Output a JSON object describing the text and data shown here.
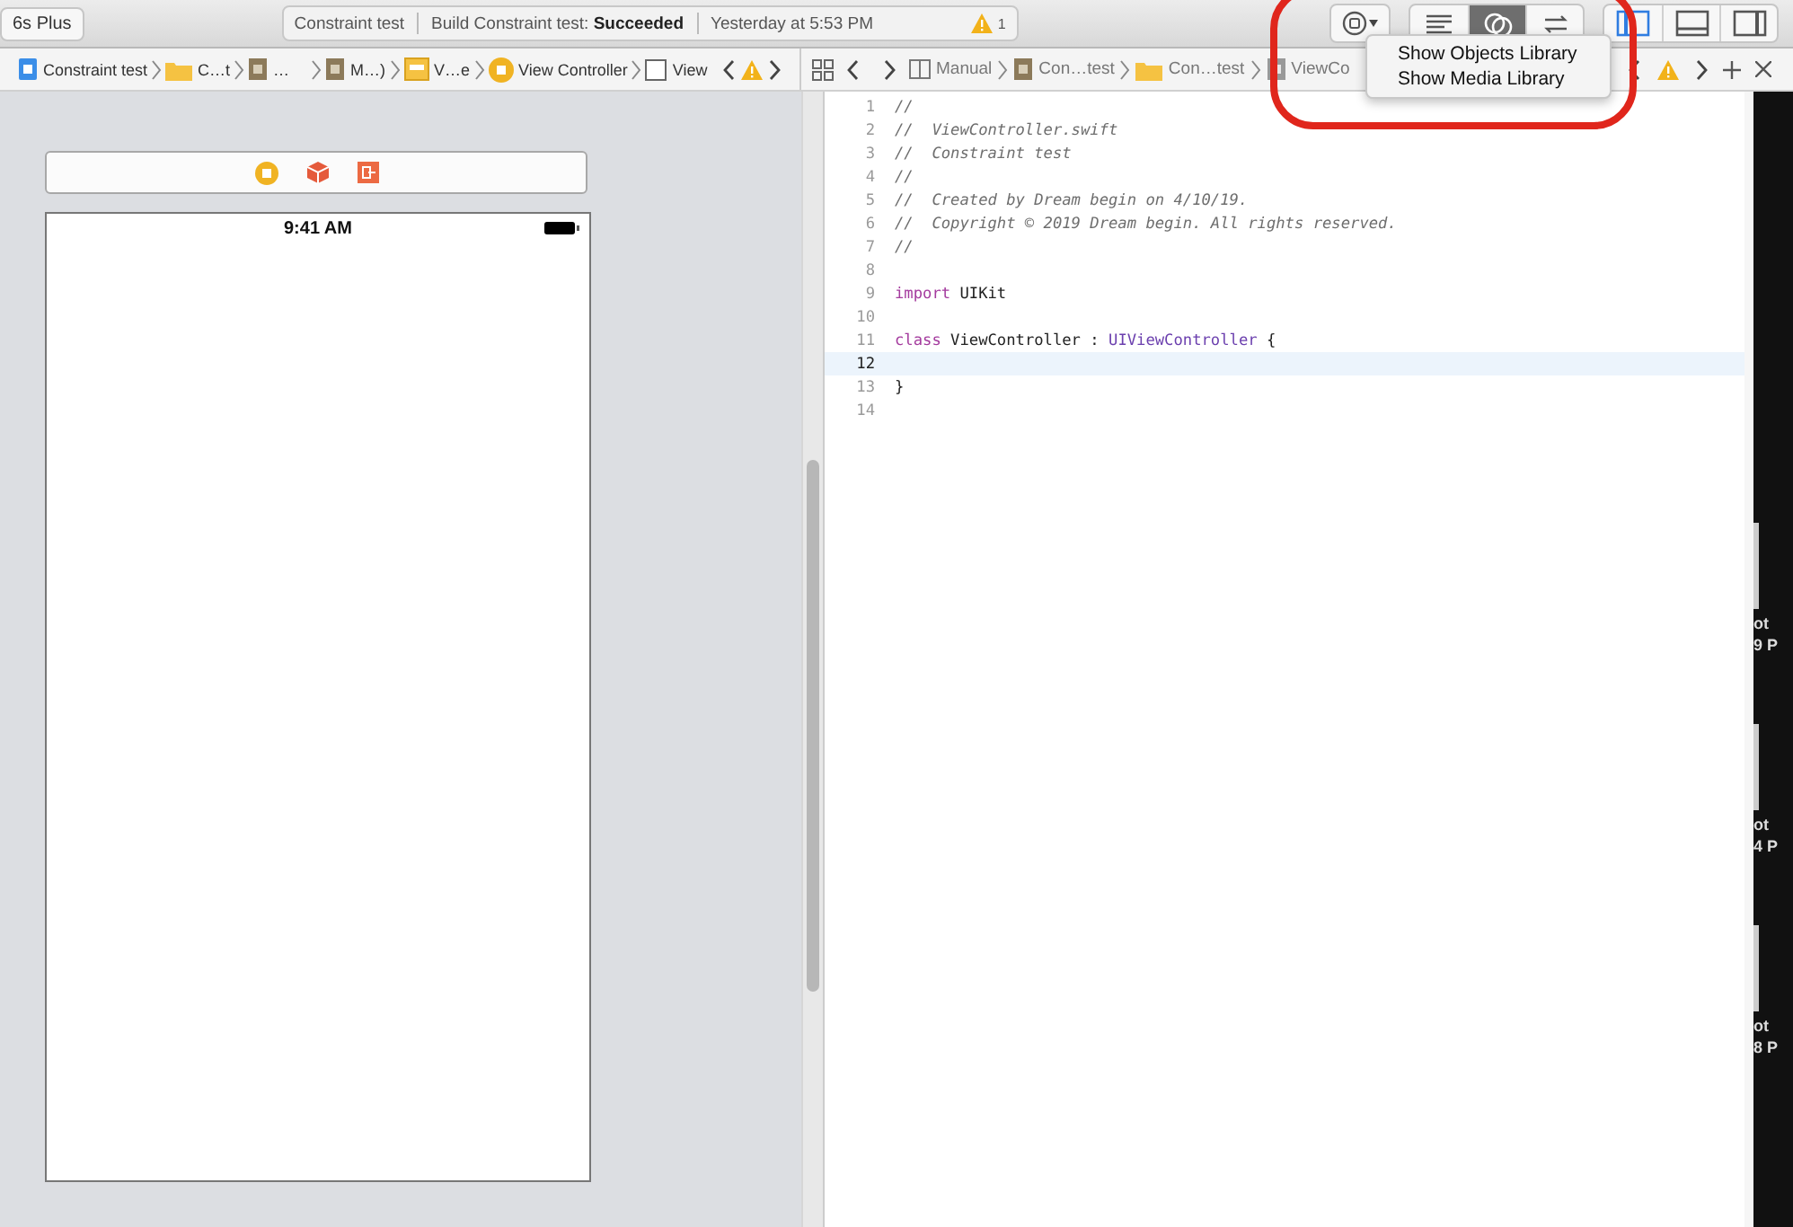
{
  "toolbar": {
    "scheme": "6s Plus",
    "activity": {
      "project": "Constraint test",
      "status": "Build Constraint test: **Succeeded**",
      "time": "Yesterday at 5:53 PM",
      "warnings": "1"
    },
    "editor_modes": [
      {
        "kind": "standard",
        "selected": false
      },
      {
        "kind": "assistant",
        "selected": true
      },
      {
        "kind": "version",
        "selected": false
      }
    ],
    "panels": [
      {
        "kind": "navigator",
        "on": true
      },
      {
        "kind": "debug",
        "on": false
      },
      {
        "kind": "utilities",
        "on": false
      }
    ]
  },
  "library_menu": {
    "items": [
      "Show Objects Library",
      "Show Media Library"
    ]
  },
  "highlight": {
    "color": "#e0261c"
  },
  "jump_bar_left": [
    {
      "kind": "project",
      "label": "Constraint test"
    },
    {
      "kind": "folder",
      "label": "C…t"
    },
    {
      "kind": "file",
      "label": "…"
    },
    {
      "kind": "file",
      "label": "M…)"
    },
    {
      "kind": "storyboard",
      "label": "V…e"
    },
    {
      "kind": "controller",
      "label": "View Controller"
    },
    {
      "kind": "view",
      "label": "View"
    }
  ],
  "jump_bar_right": [
    {
      "kind": "manual",
      "label": "Manual"
    },
    {
      "kind": "file",
      "label": "Con…test"
    },
    {
      "kind": "folder",
      "label": "Con…test"
    },
    {
      "kind": "swift",
      "label": "ViewCo"
    }
  ],
  "canvas": {
    "status_time": "9:41 AM"
  },
  "code": [
    {
      "number": "1",
      "current": false,
      "tokens": [
        {
          "kind": "comment",
          "text": "//"
        }
      ]
    },
    {
      "number": "2",
      "current": false,
      "tokens": [
        {
          "kind": "comment",
          "text": "//  ViewController.swift"
        }
      ]
    },
    {
      "number": "3",
      "current": false,
      "tokens": [
        {
          "kind": "comment",
          "text": "//  Constraint test"
        }
      ]
    },
    {
      "number": "4",
      "current": false,
      "tokens": [
        {
          "kind": "comment",
          "text": "//"
        }
      ]
    },
    {
      "number": "5",
      "current": false,
      "tokens": [
        {
          "kind": "comment",
          "text": "//  Created by Dream begin on 4/10/19."
        }
      ]
    },
    {
      "number": "6",
      "current": false,
      "tokens": [
        {
          "kind": "comment",
          "text": "//  Copyright © 2019 Dream begin. All rights reserved."
        }
      ]
    },
    {
      "number": "7",
      "current": false,
      "tokens": [
        {
          "kind": "comment",
          "text": "//"
        }
      ]
    },
    {
      "number": "8",
      "current": false
    },
    {
      "number": "9",
      "current": false,
      "tokens": [
        {
          "kind": "keyword",
          "text": "import"
        },
        {
          "kind": "plain",
          "text": " UIKit"
        }
      ]
    },
    {
      "number": "10",
      "current": false
    },
    {
      "number": "11",
      "current": false,
      "tokens": [
        {
          "kind": "keyword",
          "text": "class"
        },
        {
          "kind": "plain",
          "text": " ViewController : "
        },
        {
          "kind": "type",
          "text": "UIViewController"
        },
        {
          "kind": "plain",
          "text": " {"
        }
      ]
    },
    {
      "number": "12",
      "current": true
    },
    {
      "number": "13",
      "current": false,
      "tokens": [
        {
          "kind": "plain",
          "text": "}"
        }
      ]
    },
    {
      "number": "14",
      "current": false
    }
  ],
  "desktop_labels": [
    "ot",
    "9 P",
    "ot",
    "4 P",
    "ot",
    "8 P"
  ]
}
